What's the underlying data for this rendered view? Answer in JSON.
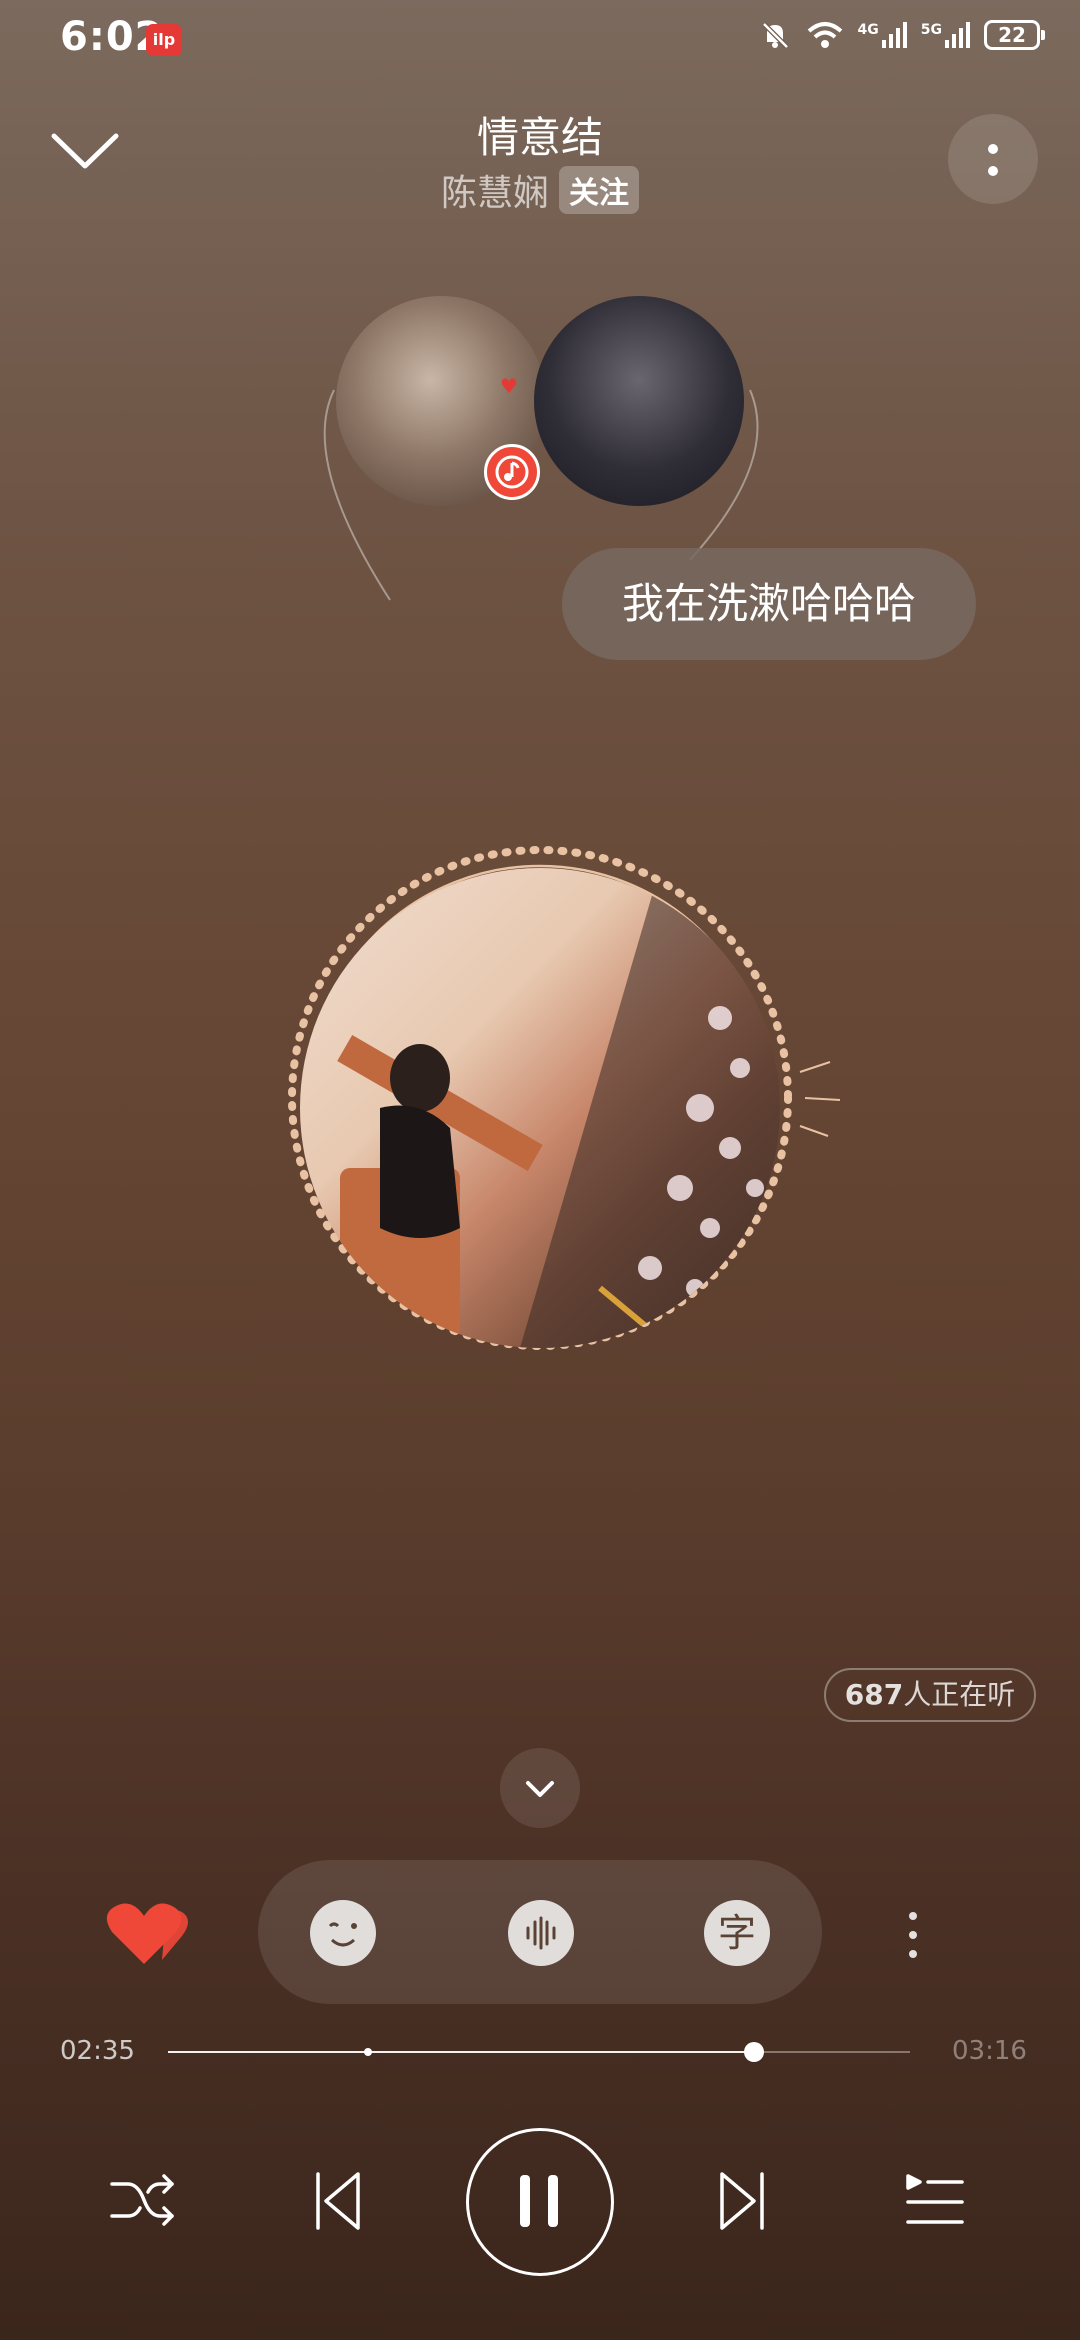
{
  "status_bar": {
    "time": "6:02",
    "app_logo": "ilp",
    "battery": "22",
    "network_1": "4G",
    "network_2": "5G"
  },
  "header": {
    "title": "情意结",
    "artist": "陈慧娴",
    "follow_label": "关注"
  },
  "comment_bubble": {
    "text": "我在洗漱哈哈哈"
  },
  "listeners": {
    "count": "687",
    "suffix": "人正在听"
  },
  "tools": {
    "lyrics_label": "字"
  },
  "player": {
    "current_time": "02:35",
    "total_time": "03:16",
    "progress": 0.79,
    "buffer_marker": 0.27
  },
  "colors": {
    "like": "#f04838",
    "accent_ring": "#e8c2a2"
  },
  "icons": [
    "chevron-down-icon",
    "more-vertical-icon",
    "music-note-icon",
    "heart-icon",
    "wink-face-icon",
    "sound-wave-icon",
    "lyrics-icon",
    "shuffle-icon",
    "previous-icon",
    "pause-icon",
    "next-icon",
    "playlist-icon"
  ]
}
